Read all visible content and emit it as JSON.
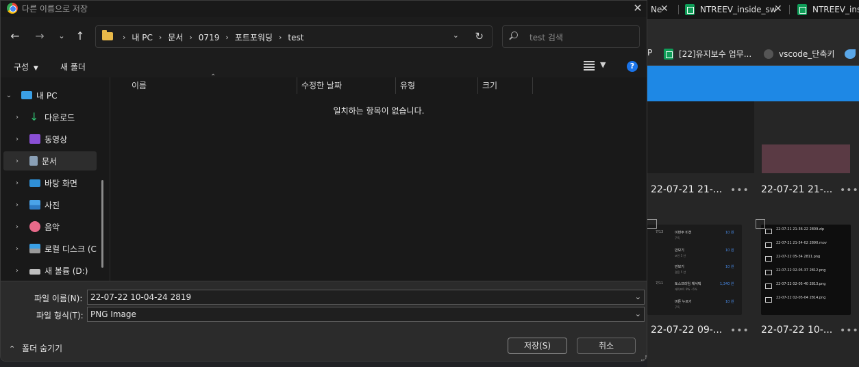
{
  "dialog": {
    "title": "다른 이름으로 저장",
    "breadcrumbs": [
      "내 PC",
      "문서",
      "0719",
      "포트포워딩",
      "test"
    ],
    "search_placeholder": "test 검색",
    "toolbar": {
      "organize_label": "구성",
      "new_folder_label": "새 폴더"
    },
    "nav_tree": [
      {
        "label": "내 PC",
        "icon": "pc-icon",
        "expanded": true
      },
      {
        "label": "다운로드",
        "icon": "download-icon"
      },
      {
        "label": "동영상",
        "icon": "video-icon"
      },
      {
        "label": "문서",
        "icon": "document-icon",
        "selected": true
      },
      {
        "label": "바탕 화면",
        "icon": "desktop-icon"
      },
      {
        "label": "사진",
        "icon": "picture-icon"
      },
      {
        "label": "음악",
        "icon": "music-icon"
      },
      {
        "label": "로컬 디스크 (C",
        "icon": "local-disk-icon"
      },
      {
        "label": "새 볼륨 (D:)",
        "icon": "drive-icon"
      }
    ],
    "columns": [
      "이름",
      "수정한 날짜",
      "유형",
      "크기"
    ],
    "empty_message": "일치하는 항목이 없습니다.",
    "filename_label": "파일 이름(N):",
    "filename_value": "22-07-22 10-04-24 2819",
    "filetype_label": "파일 형식(T):",
    "filetype_value": "PNG Image",
    "hide_folders_label": "폴더 숨기기",
    "save_label": "저장(S)",
    "cancel_label": "취소"
  },
  "background": {
    "tabs": [
      {
        "label": "NTREEV_inside_sw"
      },
      {
        "label": "NTREEV_inside_sw"
      }
    ],
    "tab_partial": "Ne",
    "bookmarks": [
      {
        "label": "P"
      },
      {
        "label": "[22]유지보수 업무..."
      },
      {
        "label": "vscode_단축키"
      }
    ],
    "captions": [
      "22-07-21 21-...",
      "22-07-21 21-...",
      "22-07-22 09-...",
      "22-07-22 10-..."
    ],
    "thumb_left_rows": [
      {
        "title": "이번주 미션",
        "sub": "구독",
        "amount": "10 원"
      },
      {
        "title": "만보기",
        "sub": "코인 5 년",
        "amount": "10 원"
      },
      {
        "title": "만보기",
        "sub": "걸음 5 년",
        "amount": "10 원"
      },
      {
        "title": "토스프라임 체서택",
        "sub": "캐릭프트 9% · 6%",
        "amount": "1,340 원"
      },
      {
        "title": "버튼 누르기",
        "sub": "구독",
        "amount": "10 원"
      }
    ],
    "thumb_left_dates": [
      "7/13",
      "7/11"
    ],
    "thumb_right_files": [
      "22-07-21 21-36-22 2809.zip",
      "22-07-21 21-54-02 2890.mov",
      "22-07-22 05-34 2811.png",
      "22-07-22 02-05-37 2812.png",
      "22-07-22 02-05-40 2813.png",
      "22-07-22 02-05-04 2814.png"
    ]
  }
}
